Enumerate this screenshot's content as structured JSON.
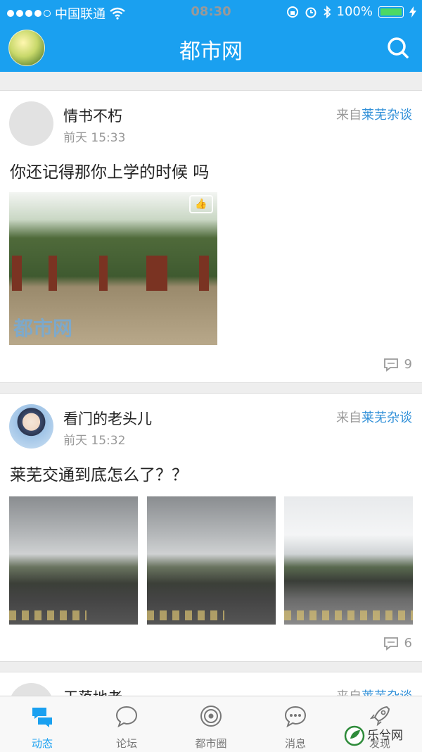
{
  "status_bar": {
    "carrier": "中国联通",
    "time": "08:30",
    "battery": "100%"
  },
  "nav": {
    "title": "都市网"
  },
  "posts": [
    {
      "user": "情书不朽",
      "time": "前天 15:33",
      "source_prefix": "来自",
      "source_name": "莱芜杂谈",
      "content": "你还记得那你上学的时候 吗",
      "comments": "9",
      "photo_watermark": "都市网"
    },
    {
      "user": "看门的老头儿",
      "time": "前天 15:32",
      "source_prefix": "来自",
      "source_name": "莱芜杂谈",
      "content": "莱芜交通到底怎么了？？",
      "comments": "6"
    },
    {
      "user": "干落地老",
      "source_prefix": "来自",
      "source_name": "莱芜杂谈"
    }
  ],
  "tabs": [
    {
      "label": "动态",
      "icon": "chat-bubbles-icon",
      "active": true
    },
    {
      "label": "论坛",
      "icon": "speech-bubble-icon"
    },
    {
      "label": "都市圈",
      "icon": "circle-eye-icon"
    },
    {
      "label": "消息",
      "icon": "message-dots-icon"
    },
    {
      "label": "发现",
      "icon": "rocket-icon"
    }
  ],
  "corner_watermark": {
    "text": "乐兮网"
  },
  "colors": {
    "primary": "#1aa0f0",
    "link": "#2f8fd8"
  }
}
